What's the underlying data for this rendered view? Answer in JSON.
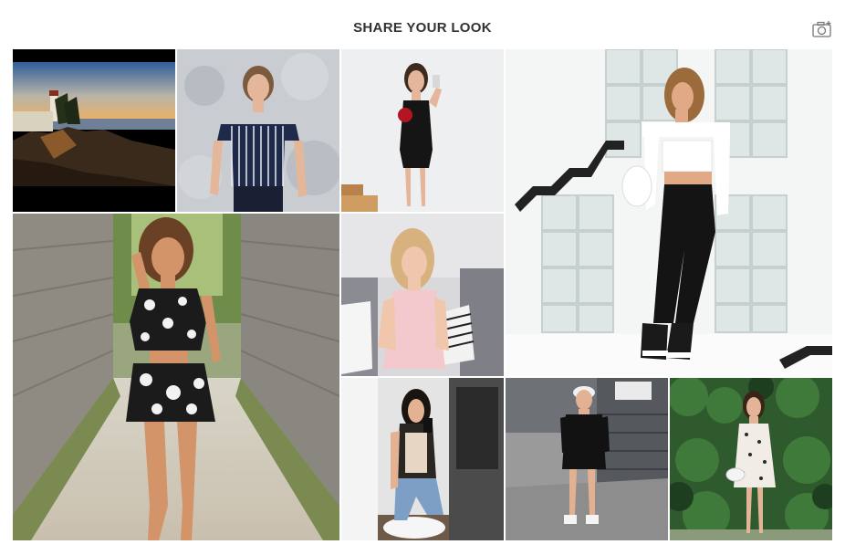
{
  "header": {
    "title": "SHARE YOUR LOOK",
    "camera_icon": "camera-add-icon"
  },
  "gallery": {
    "tiles": [
      {
        "name": "lighthouse-sunset",
        "description_icon": "photo"
      },
      {
        "name": "striped-offshoulder-top"
      },
      {
        "name": "black-dress-mirror-selfie"
      },
      {
        "name": "white-crop-top-glass-wall"
      },
      {
        "name": "floral-two-piece-alley"
      },
      {
        "name": "pink-top-sofa"
      },
      {
        "name": "jeans-mirror-selfie"
      },
      {
        "name": "black-tshirt-dress-cap"
      },
      {
        "name": "floral-dress-hedge"
      }
    ]
  }
}
